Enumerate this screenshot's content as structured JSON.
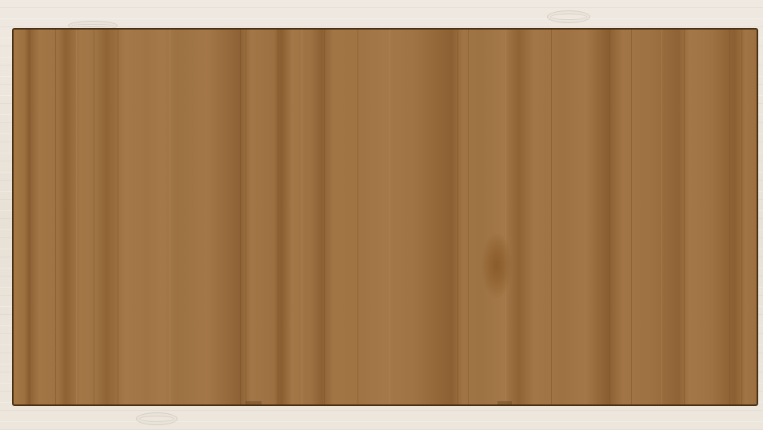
{
  "scene": {
    "background_texture": "light-wood-planks",
    "board_texture": "brown-wood-panel",
    "colors": {
      "background": "#ebe5dc",
      "board": "#a07444",
      "board_border": "#4a3012"
    }
  }
}
